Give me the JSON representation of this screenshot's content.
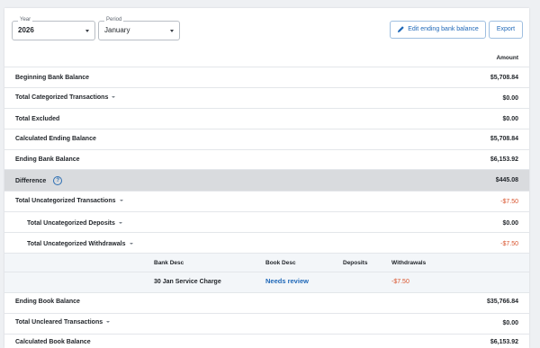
{
  "filters": {
    "year": {
      "label": "Year",
      "value": "2026"
    },
    "period": {
      "label": "Period",
      "value": "January"
    }
  },
  "actions": {
    "edit_label": "Edit ending bank balance",
    "export_label": "Export"
  },
  "table": {
    "amount_header": "Amount",
    "rows": {
      "beginning_bank_balance": {
        "label": "Beginning Bank Balance",
        "amount": "$5,708.84"
      },
      "total_categorized": {
        "label": "Total Categorized Transactions",
        "amount": "$0.00"
      },
      "total_excluded": {
        "label": "Total Excluded",
        "amount": "$0.00"
      },
      "calculated_ending_balance": {
        "label": "Calculated Ending Balance",
        "amount": "$5,708.84"
      },
      "ending_bank_balance": {
        "label": "Ending Bank Balance",
        "amount": "$6,153.92"
      },
      "difference": {
        "label": "Difference",
        "help": "?",
        "amount": "$445.08"
      },
      "total_uncategorized": {
        "label": "Total Uncategorized Transactions",
        "amount": "-$7.50"
      },
      "total_uncategorized_deposits": {
        "label": "Total Uncategorized Deposits",
        "amount": "$0.00"
      },
      "total_uncategorized_withdrawals": {
        "label": "Total Uncategorized Withdrawals",
        "amount": "-$7.50"
      },
      "ending_book_balance": {
        "label": "Ending Book Balance",
        "amount": "$35,766.84"
      },
      "total_uncleared": {
        "label": "Total Uncleared Transactions",
        "amount": "$0.00"
      },
      "calculated_book_balance": {
        "label": "Calculated Book Balance",
        "amount": "$6,153.92"
      }
    }
  },
  "subtable": {
    "headers": {
      "bank_desc": "Bank Desc",
      "book_desc": "Book Desc",
      "deposits": "Deposits",
      "withdrawals": "Withdrawals"
    },
    "rows": [
      {
        "bank_desc": "30 Jan Service Charge",
        "book_desc": "Needs review",
        "deposits": "",
        "withdrawals": "-$7.50"
      }
    ]
  },
  "colors": {
    "accent": "#1f68b8",
    "negative": "#d9532c",
    "highlight_row": "#d9dbde",
    "subtable_bg": "#f3f6f9"
  }
}
